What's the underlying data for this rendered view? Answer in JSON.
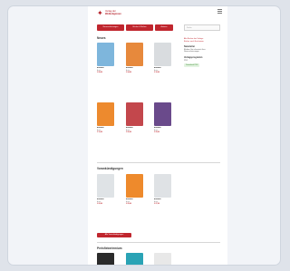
{
  "header": {
    "logo_text_1": "Verlag der",
    "logo_text_2": "Weltreligionen",
    "logo_mark": "✦"
  },
  "nav": {
    "items": [
      "Neuerscheinungen",
      "Bücher & Reihen",
      "Autoren"
    ],
    "search_placeholder": "Suche"
  },
  "sections": {
    "new_title": "Neues",
    "upcoming_title": "Vorankündigungen",
    "all_button": "Alle Vorankündigungen",
    "classics_title": "Preisfieberlemium"
  },
  "sidebar": {
    "links": [
      "Alle Bücher des Verlags",
      "Bücher nach Erscheinen"
    ],
    "newsletter_title": "Newsletter",
    "newsletter_text": "Bleiben Sie informiert über",
    "newsletter_text2": "Neuerscheinungen",
    "catalog_title": "Verlagsprogramm",
    "catalog_text": "PDF",
    "badge": "Download PDF"
  },
  "books_new": [
    {
      "title": "Buchtitel",
      "author": "Autor",
      "price": "€ 28,00",
      "color": "#7eb6dc"
    },
    {
      "title": "Buchtitel",
      "author": "Autor",
      "price": "€ 24,00",
      "color": "#e7893c"
    },
    {
      "title": "Buchtitel",
      "author": "Autor",
      "price": "€ 32,00",
      "color": "#d9dcdf"
    },
    {
      "title": "Buchtitel",
      "author": "Autor",
      "price": "€ 19,00",
      "color": "#ed8a2e"
    },
    {
      "title": "Buchtitel",
      "author": "Autor",
      "price": "€ 26,00",
      "color": "#c3474c"
    },
    {
      "title": "Buchtitel",
      "author": "Autor",
      "price": "€ 29,00",
      "color": "#6a4a8b"
    }
  ],
  "books_upcoming": [
    {
      "title": "Buchtitel",
      "author": "Autor",
      "price": "€ 22,00",
      "color": "#dfe3e6"
    },
    {
      "title": "Buchtitel",
      "author": "Autor",
      "price": "€ 25,00",
      "color": "#ee8a2c"
    },
    {
      "title": "Buchtitel",
      "author": "Autor",
      "price": "€ 27,00",
      "color": "#dfe2e5"
    }
  ],
  "books_classics": [
    {
      "color": "#2b2b2b"
    },
    {
      "color": "#2aa3b5"
    },
    {
      "color": "#e8e8e8"
    }
  ]
}
